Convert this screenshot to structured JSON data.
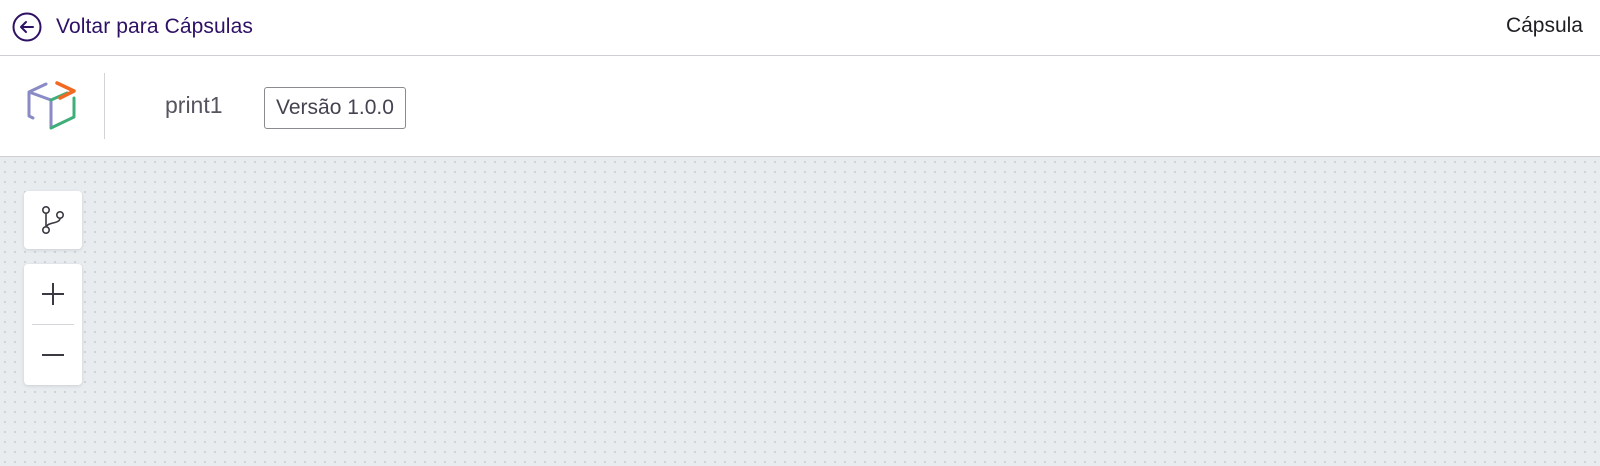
{
  "topbar": {
    "back_label": "Voltar para Cápsulas",
    "back_icon": "arrow-left-circle-icon",
    "right_label": "Cápsula"
  },
  "header": {
    "logo_icon": "capsule-cube-logo",
    "capsule_name": "print1",
    "version_badge": "Versão 1.0.0"
  },
  "canvas_tools": {
    "flow_icon": "git-branch-icon",
    "zoom_in_icon": "plus-icon",
    "zoom_out_icon": "minus-icon"
  },
  "colors": {
    "accent": "#2e1065",
    "canvas_bg": "#e8ecef",
    "logo_orange": "#f26a21",
    "logo_green": "#3fae7a",
    "logo_purple": "#8a8ac6"
  }
}
